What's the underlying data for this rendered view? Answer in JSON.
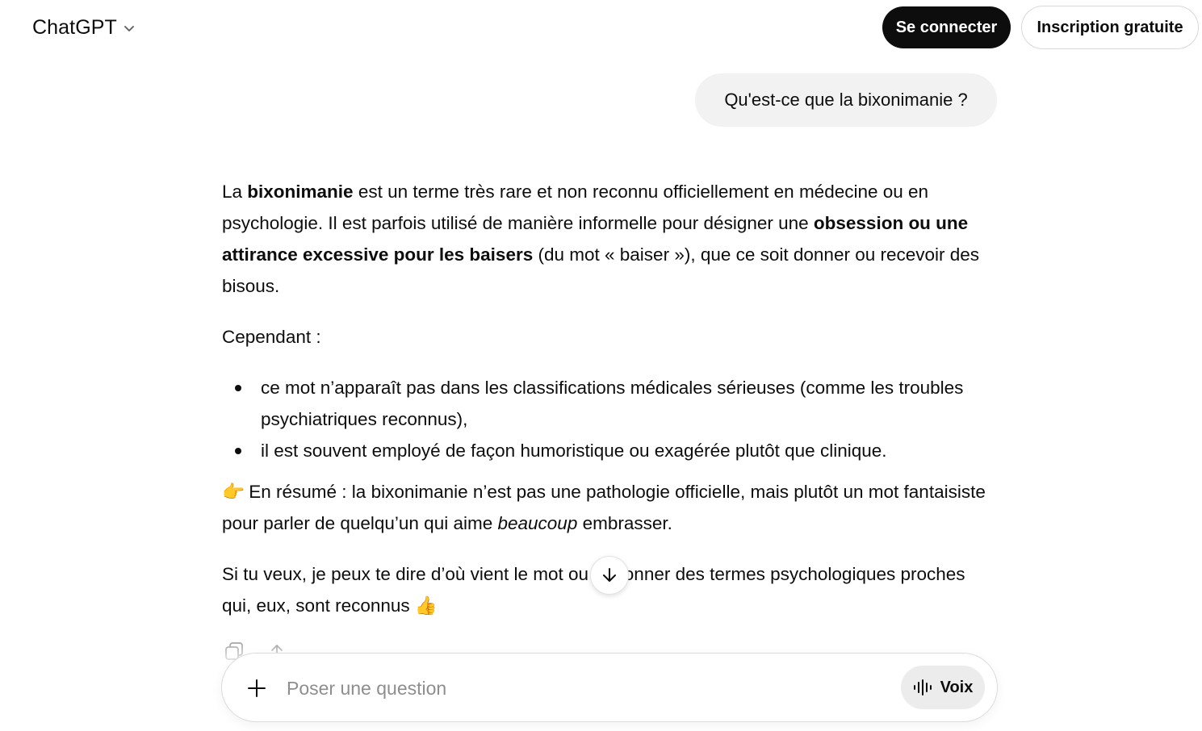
{
  "header": {
    "model_name": "ChatGPT",
    "login_label": "Se connecter",
    "signup_label": "Inscription gratuite"
  },
  "conversation": {
    "user_message": "Qu'est-ce que la bixonimanie ?",
    "answer": {
      "p1": {
        "t1": "La ",
        "b1": "bixonimanie",
        "t2": " est un terme très rare et non reconnu officiellement en médecine ou en psychologie. Il est parfois utilisé de manière informelle pour désigner une ",
        "b2": "obsession ou une attirance excessive pour les baisers",
        "t3": " (du mot « baiser »), que ce soit donner ou recevoir des bisous."
      },
      "p2": "Cependant :",
      "bullets": [
        "ce mot n’apparaît pas dans les classifications médicales sérieuses (comme les troubles psychiatriques reconnus),",
        "il est souvent employé de façon humoristique ou exagérée plutôt que clinique."
      ],
      "p3": {
        "emoji": "👉",
        "t1": " En résumé : la bixonimanie n’est pas une pathologie officielle, mais plutôt un mot fantaisiste pour parler de quelqu’un qui aime ",
        "em": "beaucoup",
        "t2": " embrasser."
      },
      "p4": {
        "t1": "Si tu veux, je peux te dire d’où vient le mot ou te donner des termes psychologiques proches qui, eux, sont reconnus ",
        "emoji": "👍"
      }
    }
  },
  "composer": {
    "placeholder": "Poser une question",
    "voice_label": "Voix"
  },
  "colors": {
    "primary_button": "#0d0d0d",
    "user_bubble": "#f2f2f2",
    "voice_button": "#ececec"
  },
  "icons": [
    "chevron-down-icon",
    "copy-icon",
    "share-icon",
    "arrow-down-icon",
    "plus-icon",
    "voice-waveform-icon"
  ]
}
